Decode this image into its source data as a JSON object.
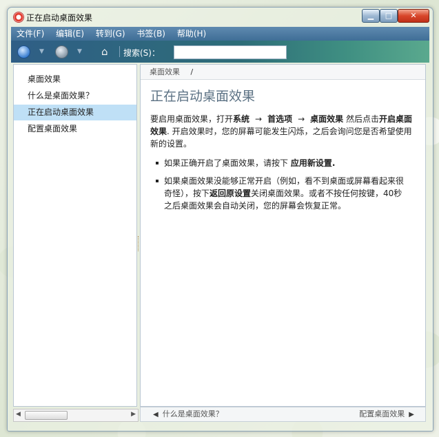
{
  "window": {
    "title": "正在启动桌面效果",
    "minimize": "▁",
    "maximize": "□",
    "close": "✕"
  },
  "menu": {
    "items": [
      "文件(F)",
      "编辑(E)",
      "转到(G)",
      "书签(B)",
      "帮助(H)"
    ]
  },
  "toolbar": {
    "search_label": "搜索(S)：",
    "search_value": "",
    "search_placeholder": ""
  },
  "sidebar": {
    "items": [
      "桌面效果",
      "什么是桌面效果？",
      "正在启动桌面效果",
      "配置桌面效果"
    ],
    "active_index": 2
  },
  "content": {
    "breadcrumb": "桌面效果",
    "breadcrumb_sep": "/",
    "title": "正在启动桌面效果",
    "intro_1": "要启用桌面效果，打开",
    "intro_system": "系统",
    "intro_arrow": "→",
    "intro_prefs": "首选项",
    "intro_effects": "桌面效果",
    "intro_2": "然后点击",
    "intro_enable": "开启桌面效果",
    "intro_3": ". 开启效果时，您的屏幕可能发生闪烁，之后会询问您是否希望使用新的设置。",
    "bullet1_a": "如果正确开启了桌面效果，请按下",
    "bullet1_b": "应用新设置",
    "bullet1_c": ".",
    "bullet2_a": "如果桌面效果没能够正常开启（例如，看不到桌面或屏幕看起来很奇怪），按下",
    "bullet2_b": "返回原设置",
    "bullet2_c": "关闭桌面效果。或者不按任何按键，40秒之后桌面效果会自动关闭，您的屏幕会恢复正常。"
  },
  "footer": {
    "prev_label": "什么是桌面效果？",
    "next_label": "配置桌面效果"
  }
}
